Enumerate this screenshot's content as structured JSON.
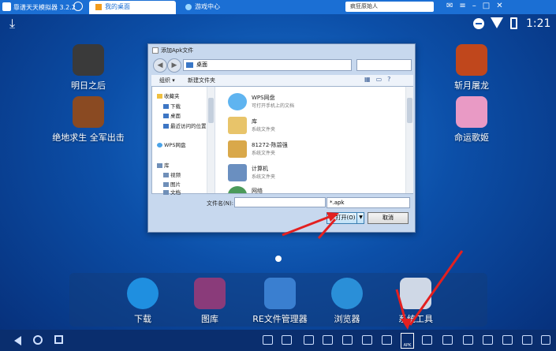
{
  "window": {
    "title": "靠谱天天模拟器 3.2.2",
    "tabs": [
      {
        "label": "我的桌面"
      },
      {
        "label": "游戏中心"
      }
    ],
    "search_value": "疯狂原始人"
  },
  "statusbar": {
    "time": "1:21"
  },
  "desktop_apps": [
    {
      "label": "明日之后",
      "color": "#3a3a3a"
    },
    {
      "label": "绝地求生 全军出击",
      "color": "#8a4a22"
    },
    {
      "label": "斩月屠龙",
      "color": "#c0471c"
    },
    {
      "label": "命运歌姬",
      "color": "#e99ac5"
    }
  ],
  "dialog": {
    "title": "添加Apk文件",
    "address": "桌面",
    "toolbar": {
      "organize": "组织 ▾",
      "new_folder": "新建文件夹"
    },
    "nav_items": [
      {
        "label": "收藏夹",
        "color": "#f0c040"
      },
      {
        "label": "下载",
        "color": "#3d76c4"
      },
      {
        "label": "桌面",
        "color": "#3d76c4"
      },
      {
        "label": "最近访问的位置",
        "color": "#3d76c4"
      },
      {
        "label": "WPS网盘",
        "color": "#4aa3e8"
      },
      {
        "label": "库",
        "color": "#6f8fb8"
      },
      {
        "label": "视频",
        "color": "#6f8fb8"
      },
      {
        "label": "图片",
        "color": "#6f8fb8"
      },
      {
        "label": "文档",
        "color": "#6f8fb8"
      }
    ],
    "files": [
      {
        "name": "WPS网盘",
        "desc": "可打开手机上的文档",
        "color": "#5fb4f0"
      },
      {
        "name": "库",
        "desc": "系统文件夹",
        "color": "#e8c46a"
      },
      {
        "name": "81272-陈碧强",
        "desc": "系统文件夹",
        "color": "#d9a84a"
      },
      {
        "name": "计算机",
        "desc": "系统文件夹",
        "color": "#6a8fc0"
      },
      {
        "name": "网络",
        "desc": "",
        "color": "#4b9a5a"
      }
    ],
    "filename_label": "文件名(N):",
    "filename_value": "",
    "filetype_value": "*.apk",
    "open_label": "打开(O)",
    "cancel_label": "取消"
  },
  "dock_apps": [
    {
      "label": "下载",
      "color": "#1f8fe0"
    },
    {
      "label": "图库",
      "color": "#8a3b7a"
    },
    {
      "label": "RE文件管理器",
      "color": "#3a7fd0"
    },
    {
      "label": "浏览器",
      "color": "#2a8fd8"
    },
    {
      "label": "系统工具",
      "color": "#cfd8e6"
    }
  ],
  "navbar": {
    "apk_label": "APK"
  }
}
